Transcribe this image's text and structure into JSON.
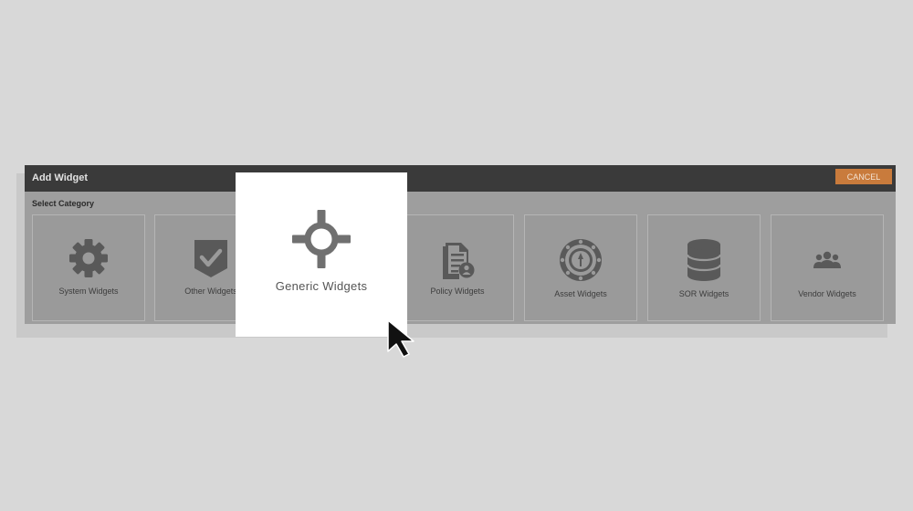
{
  "dialog": {
    "title": "Add Widget",
    "cancel_label": "CANCEL",
    "category_label": "Select Category"
  },
  "categories": [
    {
      "label": "System Widgets",
      "icon": "gear-icon"
    },
    {
      "label": "Other Widgets",
      "icon": "shield-check-icon"
    },
    {
      "label": "Generic Widgets",
      "icon": "crosshair-icon",
      "highlighted": true
    },
    {
      "label": "Policy Widgets",
      "icon": "policy-document-icon"
    },
    {
      "label": "Asset Widgets",
      "icon": "asset-wheel-icon"
    },
    {
      "label": "SOR Widgets",
      "icon": "database-icon"
    },
    {
      "label": "Vendor Widgets",
      "icon": "users-group-icon"
    }
  ],
  "colors": {
    "background": "#d8d8d8",
    "titlebar": "#3a3a3a",
    "cancel_button": "#c97b3c",
    "overlay_panel": "#9e9e9e",
    "highlight_card": "#ffffff",
    "icon_gray": "#595959"
  }
}
